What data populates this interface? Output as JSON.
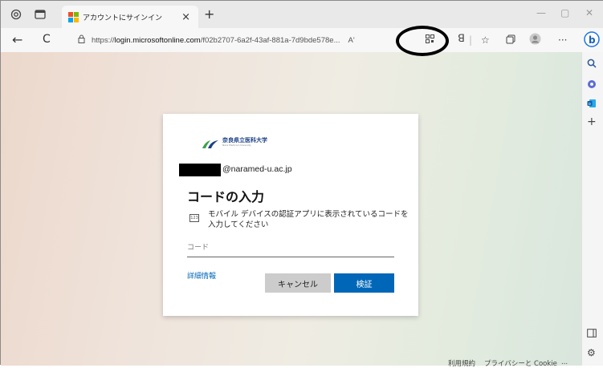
{
  "browser": {
    "tab": {
      "title": "アカウントにサインイン",
      "close_glyph": "×"
    },
    "new_tab_glyph": "+",
    "window_controls": {
      "minimize": "—",
      "maximize": "▢",
      "close": "✕"
    },
    "nav": {
      "back": "←",
      "refresh": "C"
    },
    "address": {
      "scheme": "https://",
      "host": "login.microsoftonline.com",
      "path": "/f02b2707-6a2f-43af-881a-7d9bde578e...",
      "read_aloud": "Aʹ"
    },
    "toolbar": {
      "more": "···"
    }
  },
  "sidebar": {
    "items": [
      "search-icon",
      "copilot-icon",
      "outlook-icon",
      "add-icon"
    ],
    "settings": "settings-icon"
  },
  "signin": {
    "logo": {
      "name": "奈良県立医科大学",
      "sub": "Nara Medical University"
    },
    "email_suffix": "@naramed-u.ac.jp",
    "heading": "コードの入力",
    "description_icon": "123",
    "description": "モバイル デバイスの認証アプリに表示されているコードを入力してください",
    "code_placeholder": "コード",
    "more_info": "詳細情報",
    "cancel_label": "キャンセル",
    "verify_label": "検証"
  },
  "footer": {
    "terms": "利用規約",
    "privacy": "プライバシーと Cookie",
    "more": "..."
  },
  "colors": {
    "accent": "#0067b8",
    "cancel_bg": "#cccccc",
    "logo_green": "#3aa14a",
    "logo_blue": "#1b3f86"
  }
}
